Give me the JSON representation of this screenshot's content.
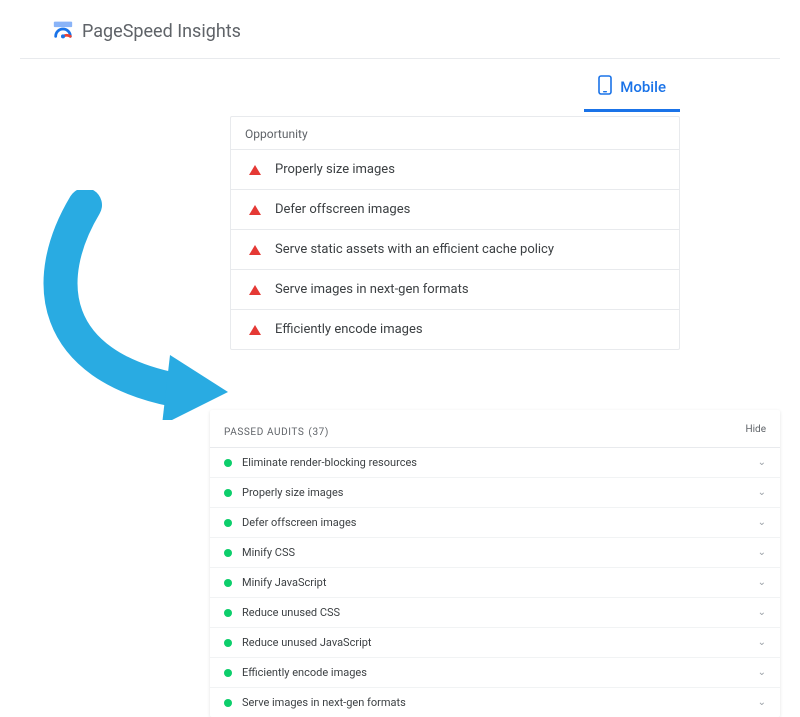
{
  "header": {
    "title": "PageSpeed Insights"
  },
  "tab": {
    "label": "Mobile"
  },
  "opportunity": {
    "section_label": "Opportunity",
    "items": [
      {
        "label": "Properly size images"
      },
      {
        "label": "Defer offscreen images"
      },
      {
        "label": "Serve static assets with an efficient cache policy"
      },
      {
        "label": "Serve images in next-gen formats"
      },
      {
        "label": "Efficiently encode images"
      }
    ]
  },
  "passed": {
    "section_label": "PASSED AUDITS",
    "count": "(37)",
    "hide_label": "Hide",
    "items": [
      {
        "label": "Eliminate render-blocking resources"
      },
      {
        "label": "Properly size images"
      },
      {
        "label": "Defer offscreen images"
      },
      {
        "label": "Minify CSS"
      },
      {
        "label": "Minify JavaScript"
      },
      {
        "label": "Reduce unused CSS"
      },
      {
        "label": "Reduce unused JavaScript"
      },
      {
        "label": "Efficiently encode images"
      },
      {
        "label": "Serve images in next-gen formats"
      }
    ]
  }
}
